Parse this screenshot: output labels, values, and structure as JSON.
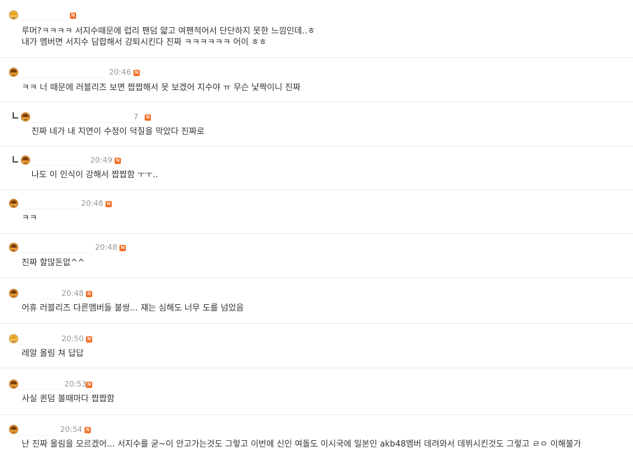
{
  "comments": [
    {
      "time": "",
      "lines": [
        "루머?ㅋㅋㅋㅋ 서지수때문에 럽리 팬덤 얇고 여팬적어서 단단하지 못한 느낌인데..ㅎ",
        "내가 멤버면 서지수 담합해서 강퇴시킨다 진짜 ㅋㅋㅋㅋㅋㅋ 어이 ㅎㅎ"
      ],
      "reply": false,
      "avatar": "blond"
    },
    {
      "time": "20:46",
      "lines": [
        "ㅋㅋ 너 때문에 러블리즈 보면 짭짭해서 못 보겠어 지수야 ㅠ 무슨 낯짝이니 진짜"
      ],
      "reply": false,
      "avatar": "brown"
    },
    {
      "time": "7",
      "lines": [
        "진짜 네가 내 지연이 수정이 덕질을 막았다 진짜로"
      ],
      "reply": true,
      "avatar": "brown"
    },
    {
      "time": "20:49",
      "lines": [
        "나도 이 인식이 강해서 짭짭함 ㅜㅜ.."
      ],
      "reply": true,
      "avatar": "brown"
    },
    {
      "time": "20:48",
      "lines": [
        "ㅋㅋ"
      ],
      "reply": false,
      "avatar": "brown"
    },
    {
      "time": "20:48",
      "lines": [
        "진짜 할많돈없^^"
      ],
      "reply": false,
      "avatar": "brown"
    },
    {
      "time": "20:48",
      "lines": [
        "어휴 러블리즈 다른멤버들 불쌍... 쟤는 심해도 너무 도를 넘었음"
      ],
      "reply": false,
      "avatar": "brown"
    },
    {
      "time": "20:50",
      "lines": [
        "레알 올림 쳐 답답"
      ],
      "reply": false,
      "avatar": "blond"
    },
    {
      "time": "20:53",
      "lines": [
        "사실 퀸덤 볼때마다 짭짭함"
      ],
      "reply": false,
      "avatar": "brown"
    },
    {
      "time": "20:54",
      "lines": [
        "난 진짜 올림을 모르겠어... 서지수를 굳~이 안고가는것도 그렇고 이번에 신인 여돌도 이시국에 일본인 akb48멤버 데려와서 데뷔시킨것도 그렇고 ㄹㅇ 이해불가"
      ],
      "reply": false,
      "avatar": "brown"
    }
  ],
  "badge_label": "N",
  "colors": {
    "badge": "#f26b21",
    "text": "#333333",
    "time": "#999999",
    "divider": "#ebebeb"
  }
}
